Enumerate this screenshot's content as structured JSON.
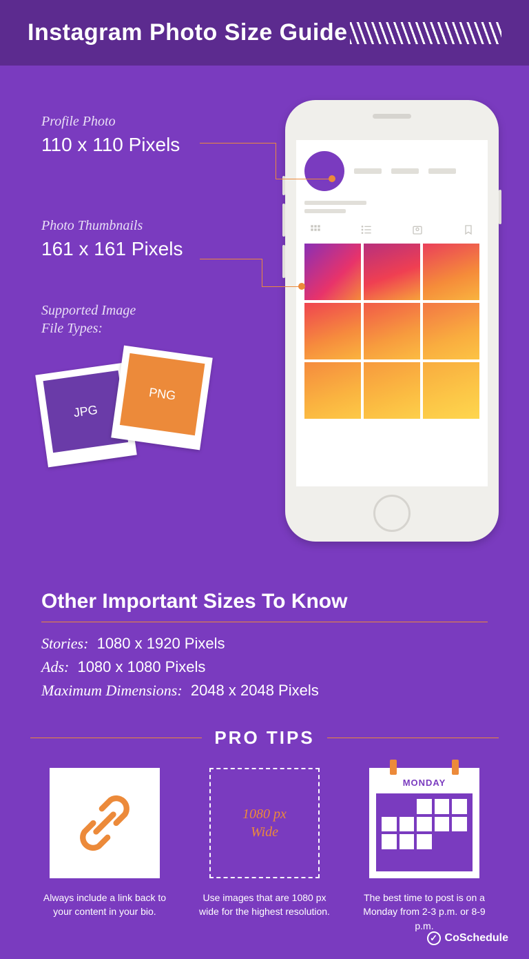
{
  "header": {
    "title": "Instagram Photo Size Guide"
  },
  "profilePhoto": {
    "label": "Profile Photo",
    "value": "110 x 110 Pixels"
  },
  "thumbnails": {
    "label": "Photo Thumbnails",
    "value": "161 x 161 Pixels"
  },
  "fileTypes": {
    "label": "Supported Image\nFile Types:",
    "types": [
      "JPG",
      "PNG"
    ]
  },
  "otherSizes": {
    "heading": "Other Important Sizes To Know",
    "rows": [
      {
        "label": "Stories:",
        "value": "1080 x 1920 Pixels"
      },
      {
        "label": "Ads:",
        "value": "1080 x 1080 Pixels"
      },
      {
        "label": "Maximum Dimensions:",
        "value": "2048 x 2048 Pixels"
      }
    ]
  },
  "proTips": {
    "heading": "PRO TIPS",
    "card2Line1": "1080 px",
    "card2Line2": "Wide",
    "card3Day": "MONDAY",
    "tips": [
      "Always include a link back to your content in your bio.",
      "Use images that are 1080 px wide for the highest resolution.",
      "The best time to post is on a Monday from 2-3 p.m. or 8-9 p.m."
    ]
  },
  "footer": {
    "brand": "CoSchedule"
  }
}
